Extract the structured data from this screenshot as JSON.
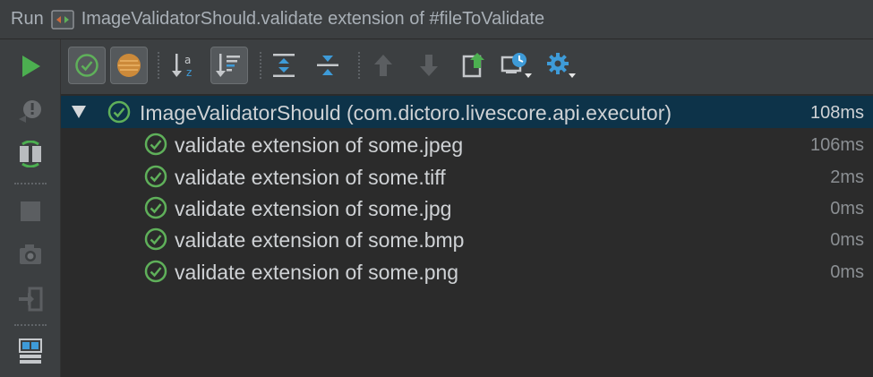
{
  "window": {
    "panel_title": "Run",
    "run_config_name": "ImageValidatorShould.validate extension of #fileToValidate"
  },
  "toolbar": {
    "buttons": [
      {
        "name": "show-passed",
        "icon": "check-circle-icon",
        "toggled": true
      },
      {
        "name": "show-ignored",
        "icon": "ignored-circle-icon",
        "toggled": true
      },
      {
        "name": "sort-alphabetically",
        "icon": "sort-alpha-icon",
        "toggled": false
      },
      {
        "name": "sort-by-duration",
        "icon": "sort-duration-icon",
        "toggled": true
      },
      {
        "name": "expand-all",
        "icon": "expand-all-icon"
      },
      {
        "name": "collapse-all",
        "icon": "collapse-all-icon"
      },
      {
        "name": "previous-failed",
        "icon": "arrow-up-icon",
        "enabled": false
      },
      {
        "name": "next-failed",
        "icon": "arrow-down-icon",
        "enabled": false
      },
      {
        "name": "export-results",
        "icon": "export-icon"
      },
      {
        "name": "test-history",
        "icon": "history-icon"
      },
      {
        "name": "settings",
        "icon": "gear-icon"
      }
    ]
  },
  "left_bar": {
    "buttons": [
      {
        "name": "rerun",
        "icon": "play-icon"
      },
      {
        "name": "rerun-failed",
        "icon": "rerun-failed-icon",
        "enabled": false
      },
      {
        "name": "toggle-auto-test",
        "icon": "auto-test-icon"
      },
      {
        "name": "stop",
        "icon": "stop-icon",
        "enabled": false
      },
      {
        "name": "dump-threads",
        "icon": "camera-icon",
        "enabled": false
      },
      {
        "name": "exit",
        "icon": "exit-icon",
        "enabled": false
      },
      {
        "name": "restore-layout",
        "icon": "layout-icon"
      }
    ]
  },
  "tree": {
    "root": {
      "label": "ImageValidatorShould (com.dictoro.livescore.api.executor)",
      "duration": "108ms",
      "status": "passed"
    },
    "children": [
      {
        "label": "validate extension of some.jpeg",
        "duration": "106ms",
        "status": "passed"
      },
      {
        "label": "validate extension of some.tiff",
        "duration": "2ms",
        "status": "passed"
      },
      {
        "label": "validate extension of some.jpg",
        "duration": "0ms",
        "status": "passed"
      },
      {
        "label": "validate extension of some.bmp",
        "duration": "0ms",
        "status": "passed"
      },
      {
        "label": "validate extension of some.png",
        "duration": "0ms",
        "status": "passed"
      }
    ]
  },
  "colors": {
    "pass_green": "#5fb05a",
    "selection": "#0d3349",
    "play_green": "#4caf50",
    "accent_blue": "#3e9bd8"
  }
}
